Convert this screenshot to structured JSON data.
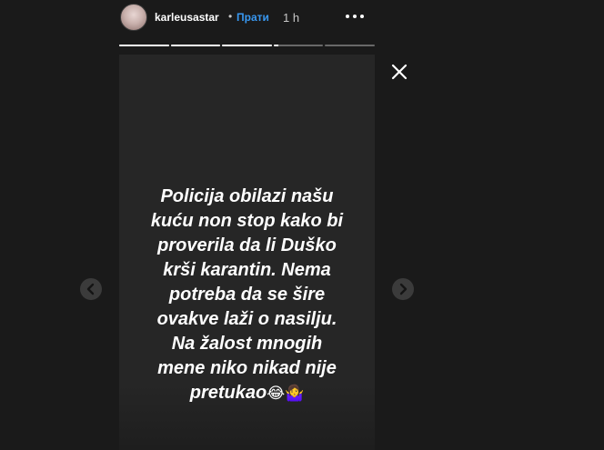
{
  "header": {
    "username": "karleusastar",
    "separator": "•",
    "follow_label": "Прати",
    "time": "1 h",
    "avatar_icon": "profile-avatar"
  },
  "progress": {
    "segments": [
      1,
      1,
      1,
      0.1,
      0
    ]
  },
  "story": {
    "lines": [
      "Policija obilazi našu",
      "kuću non stop kako bi",
      "proverila da li Duško",
      "krši karantin. Nema",
      "potreba da se šire",
      "ovakve laži o nasilju.",
      "Na žalost mnogih",
      "mene niko nikad nije",
      "pretukao"
    ],
    "emoji_1": "😂",
    "emoji_2": "🤷‍♀️"
  },
  "icons": {
    "close": "close-icon",
    "more": "more-options-icon",
    "prev": "chevron-left-icon",
    "next": "chevron-right-icon"
  },
  "colors": {
    "background": "#1a1a1a",
    "story_background": "#262626",
    "follow": "#3897f0"
  }
}
